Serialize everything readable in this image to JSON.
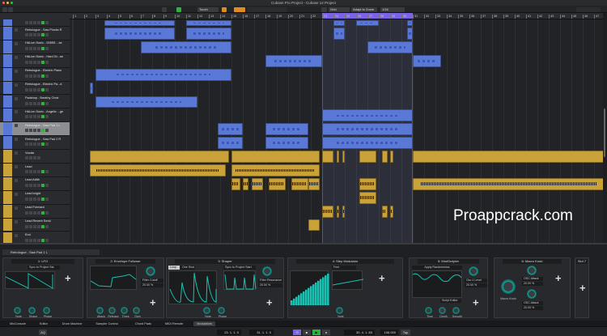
{
  "window": {
    "title": "Cubase Pro Project - Cubase 14 Project"
  },
  "toolbar": {
    "automation_mode": "Touch",
    "snap_type": "Grid",
    "grid_mode": "Adapt to Zoom",
    "quantize": "1/16"
  },
  "ruler": {
    "first_bar": 1,
    "last_bar": 47,
    "left_locator_bar": 23,
    "right_locator_bar": 31
  },
  "colors": {
    "instrument": "#5a78d6",
    "vocal": "#caa23a",
    "accent": "#7b63e8",
    "mod_teal": "#17c2b3",
    "play_green": "#2fb33a"
  },
  "tracks": [
    {
      "name": "",
      "color": "blue",
      "clips": [
        [
          3.75,
          10
        ],
        [
          11,
          15
        ],
        [
          24,
          25
        ],
        [
          26,
          28
        ],
        [
          30.5,
          31
        ]
      ]
    },
    {
      "name": "Retrologue - Saw Plucks R",
      "color": "blue",
      "clips": [
        [
          3.75,
          10
        ],
        [
          11,
          15
        ],
        [
          24,
          25
        ],
        [
          30.5,
          31
        ]
      ]
    },
    {
      "name": "HALion Sonic - 008S5 ...se",
      "color": "blue",
      "clips": [
        [
          7,
          15
        ],
        [
          27,
          31
        ]
      ]
    },
    {
      "name": "HALion Sonic - Hard Gr...se",
      "color": "blue",
      "clips": [
        [
          18,
          23
        ],
        [
          31,
          33.5
        ]
      ]
    },
    {
      "name": "Retrologue - Electric Piano",
      "color": "blue",
      "clips": [
        [
          3,
          15
        ]
      ]
    },
    {
      "name": "Retrologue - Electric Pa...d",
      "color": "blue",
      "clips": [
        [
          2.5,
          2.75
        ]
      ]
    },
    {
      "name": "Padshop - Breathy Choir",
      "color": "blue",
      "clips": [
        [
          3,
          12
        ]
      ]
    },
    {
      "name": "HALion Sonic - Angelic ...ge",
      "color": "blue",
      "clips": [
        [
          23,
          31
        ]
      ]
    },
    {
      "name": "Retrologue - Saw Pad 1 L",
      "color": "blue",
      "selected": true,
      "clips": [
        [
          13.75,
          16
        ],
        [
          18,
          21.75
        ],
        [
          23,
          31
        ]
      ]
    },
    {
      "name": "Retrologue - Saw Pad 2 R",
      "color": "blue",
      "clips": [
        [
          13.75,
          16
        ],
        [
          18,
          21.75
        ],
        [
          23,
          31
        ]
      ]
    },
    {
      "name": "Vocals",
      "color": "yellow",
      "folder": true,
      "clips": [
        [
          2.5,
          14.75
        ],
        [
          15,
          22.75
        ],
        [
          23,
          24
        ],
        [
          24.25,
          24.5
        ],
        [
          24.75,
          25
        ],
        [
          26.25,
          27.75
        ],
        [
          28.25,
          28.75
        ],
        [
          29,
          29.25
        ],
        [
          31,
          48
        ]
      ]
    },
    {
      "name": "Lead",
      "color": "yellow",
      "wave": true,
      "clips": [
        [
          2.5,
          14.5
        ],
        [
          15,
          22.75
        ]
      ]
    },
    {
      "name": "Lead Adlib",
      "color": "yellow",
      "wave": true,
      "clips": [
        [
          15,
          15.75
        ],
        [
          16,
          16.5
        ],
        [
          16.75,
          17.75
        ],
        [
          18.25,
          19.75
        ],
        [
          20.25,
          21.75
        ],
        [
          21.75,
          22.75
        ],
        [
          26.25,
          27.75
        ],
        [
          31,
          48
        ]
      ]
    },
    {
      "name": "Lead bright",
      "color": "yellow",
      "wave": true,
      "clips": [
        [
          26.25,
          27.75
        ]
      ]
    },
    {
      "name": "Lead Formant",
      "color": "yellow",
      "wave": true,
      "clips": [
        [
          23,
          24
        ],
        [
          24.25,
          24.5
        ],
        [
          24.75,
          25
        ],
        [
          28.25,
          28.75
        ],
        [
          29,
          29.25
        ]
      ]
    },
    {
      "name": "Lead Reverb Send",
      "color": "yellow",
      "clips": [
        [
          21.75,
          22.75
        ]
      ]
    },
    {
      "name": "End",
      "color": "yellow",
      "clips": []
    }
  ],
  "watermark": "Proappcrack.com",
  "lower": {
    "track": "Retrologue - Saw Pad 1 L",
    "modulators": [
      {
        "title": "1: LFO",
        "sync": "Sync to Project Sta",
        "knobs": [
          "Note",
          "Shape",
          "Phase"
        ]
      },
      {
        "title": "2: Envelope Follower",
        "target": "Filter Cutoff",
        "value": "20.00 %",
        "knobs": [
          "Attack",
          "Release",
          "Thres",
          "Gain"
        ]
      },
      {
        "title": "3: Shaper",
        "mode_a": "Loop",
        "mode_b": "One Shot",
        "sync": "Sync to Project Start",
        "target": "Filter Resonance",
        "value": "20.00 %",
        "knobs": [
          "Note",
          "Phase"
        ]
      },
      {
        "title": "4: Step Modulator",
        "mode": "Free",
        "knobs": [
          "Note"
        ]
      },
      {
        "title": "5: ModScripter",
        "script": "Apply Randomness",
        "editor": "Script Editor",
        "target": "Osc 1 Level",
        "value": "20.00 %",
        "knobs": [
          "Time",
          "Depth",
          "Smooth"
        ]
      },
      {
        "title": "6: Macro Knob",
        "knob": "Macro Knob",
        "target_a": "OSC Attack",
        "value_a": "20.00 %",
        "target_b": "OSC Attack",
        "value_b": "20.00 %"
      },
      {
        "title": "Slot 7"
      }
    ]
  },
  "tabs": [
    "MixConsole",
    "Editor",
    "Drum Machine",
    "Sampler Control",
    "Chord Pads",
    "MIDI Remote",
    "Modulators"
  ],
  "active_tab": "Modulators",
  "transport": {
    "left_locator": "23. 1. 1.  0",
    "right_locator": "31. 1. 1.  0",
    "position": "30. 4. 1. 83",
    "tempo": "106.000",
    "tap": "Tap",
    "aq": "AQ"
  }
}
